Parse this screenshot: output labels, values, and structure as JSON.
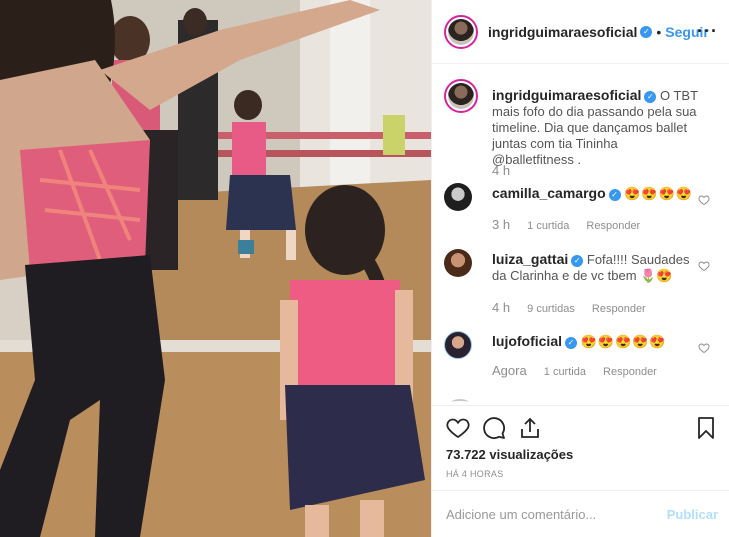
{
  "post": {
    "media_alt": "",
    "author": "ingridguimaraesoficial",
    "follow_label": "Seguir",
    "more_label": "···",
    "caption": {
      "username": "ingridguimaraesoficial",
      "text": "O TBT mais fofo do dia passando pela sua timeline. Dia que dançamos ballet juntas com tia Tininha",
      "mention": "@balletfitness",
      "trailing": " .",
      "time": "4 h"
    },
    "comments": [
      {
        "username": "camilla_camargo",
        "verified": true,
        "text": "😍😍😍😍",
        "time": "3 h",
        "likes": "1 curtida",
        "reply": "Responder"
      },
      {
        "username": "luiza_gattai",
        "verified": true,
        "text": "Fofa!!!! Saudades da Clarinha e de vc tbem 🌷😍",
        "time": "4 h",
        "likes": "9 curtidas",
        "reply": "Responder"
      },
      {
        "username": "lujofoficial",
        "verified": true,
        "text": "😍😍😍😍😍",
        "time": "Agora",
        "likes": "1 curtida",
        "reply": "Responder"
      }
    ],
    "views": "73.722 visualizações",
    "posted_ago": "HÁ 4 HORAS",
    "comment_placeholder": "Adicione um comentário...",
    "publish_label": "Publicar"
  },
  "colors": {
    "accent": "#3897f0",
    "publish_disabled": "#b2dffc",
    "muted": "#8e8e8e",
    "divider": "#efefef"
  },
  "icons": [
    "verified-badge-icon",
    "more-options-icon",
    "heart-icon",
    "comment-icon",
    "share-icon",
    "bookmark-icon"
  ]
}
